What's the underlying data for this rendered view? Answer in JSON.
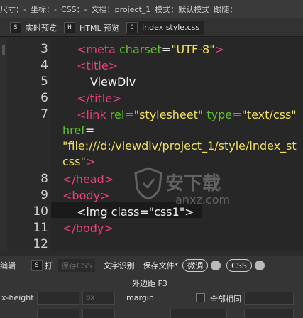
{
  "statusbar": {
    "size_label": "尺寸：-",
    "coord_label": "坐标：-",
    "css_label": "CSS：-",
    "doc_label": "文档：project_1",
    "mode_label": "模式：默认模式",
    "trail_label": "跟随："
  },
  "tabs": [
    {
      "badge": "S",
      "label": "实时预览"
    },
    {
      "badge": "H",
      "label": "HTML 预览"
    },
    {
      "badge": "C",
      "label": "index style.css"
    }
  ],
  "editor": {
    "line_numbers": [
      "3",
      "4",
      "5",
      "6",
      "7",
      "8",
      "9",
      "10",
      "11",
      "12"
    ],
    "lines": {
      "l3": {
        "open": "<meta ",
        "attr": "charset",
        "eq": "=",
        "val": "\"UTF-8\"",
        "close": ">"
      },
      "l4": {
        "tag": "<title>"
      },
      "l5": {
        "text": "ViewDiv"
      },
      "l6": {
        "tag": "</title>"
      },
      "l7": {
        "open": "<link ",
        "attr1": "rel",
        "eq1": "=",
        "val1": "\"stylesheet\"",
        "attr2": " type",
        "eq2": "=",
        "val2": "\"text/css\""
      },
      "l7b": {
        "attr": "href",
        "eq": "="
      },
      "l7c": {
        "val": "\"file:///d:/viewdiv/project_1/style/index_st"
      },
      "l7d": {
        "val": "css\"",
        "close": ">"
      },
      "l8": {
        "tag": "</head>"
      },
      "l9": {
        "tag": "<body>"
      },
      "l10": {
        "text": "<img class=\"css1\">"
      },
      "l11": {
        "tag": "</body>"
      }
    }
  },
  "watermark": {
    "text": "安下载",
    "sub": "anxz.com"
  },
  "panel": {
    "toolbar": {
      "edit_label": "编辑",
      "s_badge": "S",
      "s_label": "打",
      "save_css": "保存CSS",
      "ocr": "文字识别",
      "save_file": "保存文件*",
      "debug": "微调",
      "css": "CSS"
    },
    "section_title": "外边距 F3",
    "row": {
      "xheight": "x-height",
      "unit": "px",
      "margin": "margin",
      "same_all": "全部相同"
    }
  }
}
